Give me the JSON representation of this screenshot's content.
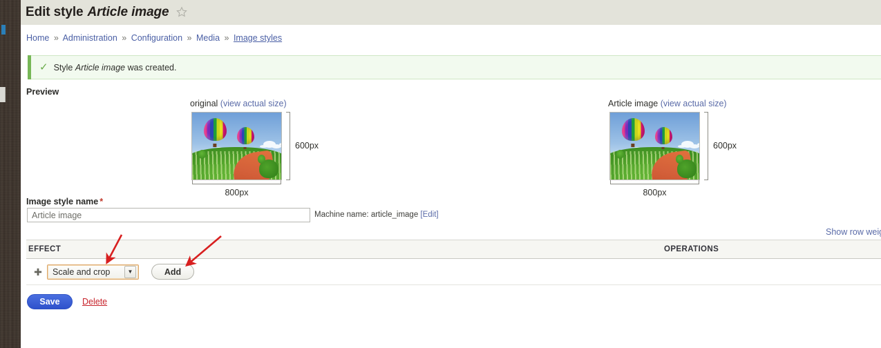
{
  "header": {
    "title_prefix": "Edit style",
    "title_style_name": "Article image",
    "favorite_icon": "star-icon"
  },
  "breadcrumb": {
    "separator": "»",
    "items": [
      {
        "label": "Home"
      },
      {
        "label": "Administration"
      },
      {
        "label": "Configuration"
      },
      {
        "label": "Media"
      },
      {
        "label": "Image styles"
      }
    ]
  },
  "status_message": {
    "icon": "check-icon",
    "text_before": "Style",
    "style_name": "Article image",
    "text_after": "was created."
  },
  "preview": {
    "section_label": "Preview",
    "original": {
      "caption": "original",
      "link": "(view actual size)",
      "width_label": "800px",
      "height_label": "600px",
      "image_alt": "hot-air-balloons-over-field"
    },
    "derived": {
      "caption": "Article image",
      "link": "(view actual size)",
      "width_label": "800px",
      "height_label": "600px",
      "image_alt": "hot-air-balloons-over-field"
    }
  },
  "name_field": {
    "label": "Image style name",
    "required_marker": "*",
    "value": "Article image",
    "placeholder": "Article image",
    "machine_name_prefix": "Machine name: article_image",
    "machine_name_edit": "[Edit]"
  },
  "row_weights": {
    "label": "Show row weights"
  },
  "effects_table": {
    "columns": [
      "EFFECT",
      "OPERATIONS"
    ],
    "row": {
      "drag_handle_icon": "drag-handle-icon",
      "select_value": "Scale and crop",
      "select_arrow_icon": "chevron-down-icon",
      "add_button": "Add"
    }
  },
  "actions": {
    "save": "Save",
    "delete": "Delete"
  },
  "colors": {
    "header_band": "#e3e3da",
    "status_green": "#77b757",
    "status_bg": "#f2faef",
    "link_blue": "#5a6ba8",
    "save_blue": "#2f52cc",
    "delete_red": "#c7222a",
    "annotation_red": "#d81f1f",
    "select_focus_border": "#dda86a",
    "toolbar_dark": "#3e352e"
  }
}
